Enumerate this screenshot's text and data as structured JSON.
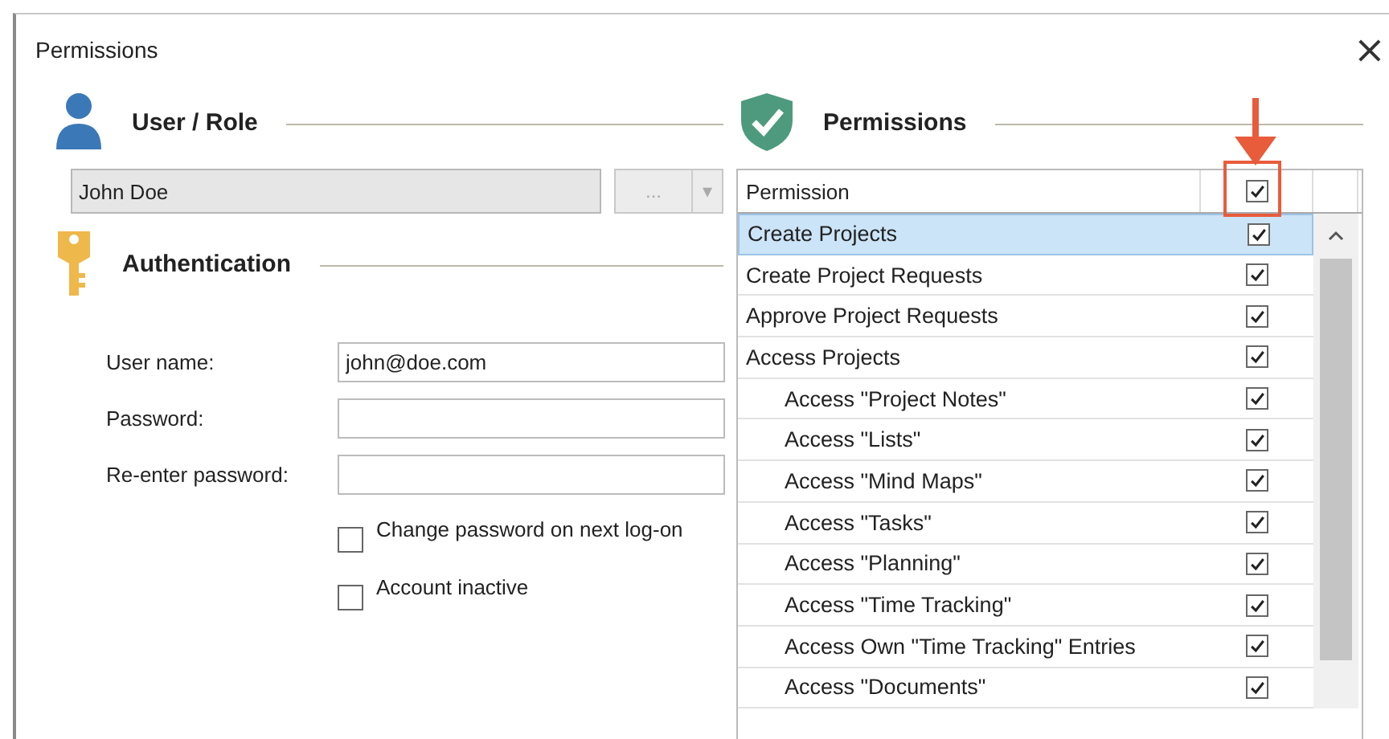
{
  "window": {
    "title": "Permissions",
    "close": "×"
  },
  "user_role": {
    "heading": "User / Role",
    "value": "John Doe",
    "browse": "...",
    "dropdown": "▾"
  },
  "authentication": {
    "heading": "Authentication",
    "fields": [
      {
        "label": "User name:",
        "value": "john@doe.com"
      },
      {
        "label": "Password:"
      },
      {
        "label": "Re-enter password:"
      }
    ],
    "options": [
      {
        "label": "Change password on next log-on",
        "checked": false
      },
      {
        "label": "Account inactive",
        "checked": false
      }
    ]
  },
  "permissions": {
    "heading": "Permissions",
    "column": "Permission",
    "header_checked": true,
    "rows": [
      {
        "label": "Create Projects",
        "checked": true,
        "selected": true
      },
      {
        "label": "Create Project Requests",
        "checked": true,
        "selected": false
      },
      {
        "label": "Approve Project Requests",
        "checked": true,
        "selected": false
      },
      {
        "label": "Access Projects",
        "checked": true,
        "selected": false,
        "children": [
          {
            "label": "Access \"Project Notes\"",
            "checked": true,
            "selected": false
          },
          {
            "label": "Access \"Lists\"",
            "checked": true,
            "selected": false
          },
          {
            "label": "Access \"Mind Maps\"",
            "checked": true,
            "selected": false
          },
          {
            "label": "Access \"Tasks\"",
            "checked": true,
            "selected": false
          },
          {
            "label": "Access \"Planning\"",
            "checked": true,
            "selected": false
          },
          {
            "label": "Access \"Time Tracking\"",
            "checked": true,
            "selected": false
          },
          {
            "label": "Access Own \"Time Tracking\" Entries",
            "checked": true,
            "selected": false
          },
          {
            "label": "Access \"Documents\"",
            "checked": true,
            "selected": false
          }
        ]
      }
    ]
  }
}
